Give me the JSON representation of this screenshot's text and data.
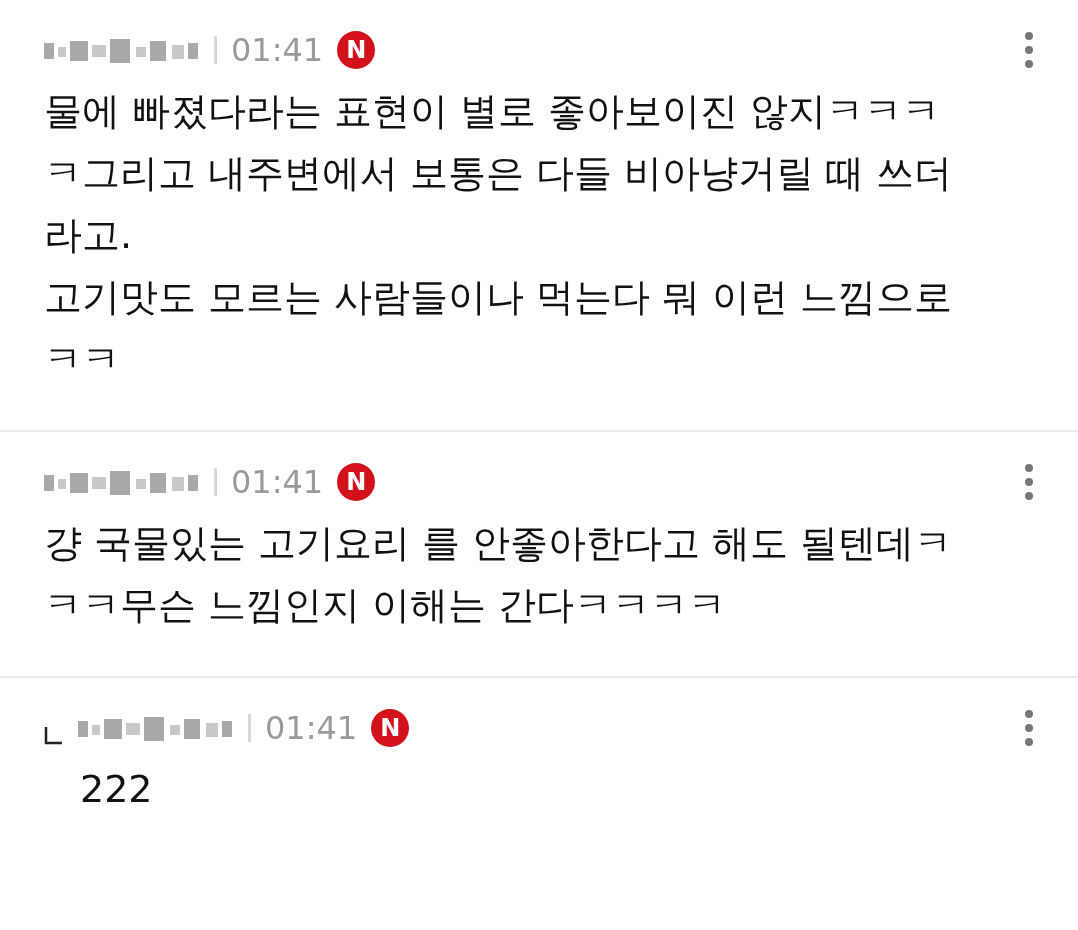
{
  "comments": [
    {
      "kind": "comment",
      "time": "01:41",
      "badge": "N",
      "text": "물에 빠졌다라는 표현이 별로 좋아보이진 않지ㅋㅋㅋㅋ그리고 내주변에서 보통은 다들 비아냥거릴 때 쓰더라고.\n고기맛도 모르는 사람들이나 먹는다 뭐 이런 느낌으로 ㅋㅋ"
    },
    {
      "kind": "comment",
      "time": "01:41",
      "badge": "N",
      "text": "걍 국물있는 고기요리 를 안좋아한다고 해도 될텐데ㅋㅋㅋ무슨 느낌인지 이해는 간다ㅋㅋㅋㅋ"
    },
    {
      "kind": "reply",
      "time": "01:41",
      "badge": "N",
      "text": "222"
    }
  ]
}
